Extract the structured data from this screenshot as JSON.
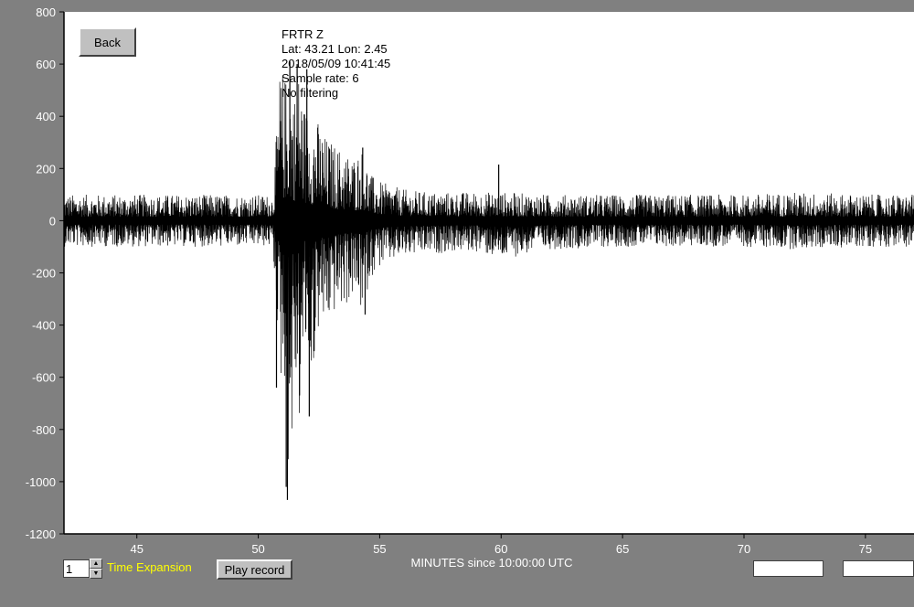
{
  "window": {
    "background": "#808080",
    "plot_background": "#ffffff",
    "trace_color": "#000000"
  },
  "info": {
    "station": "FRTR  Z",
    "location": "Lat: 43.21 Lon: 2.45",
    "datetime": "2018/05/09 10:41:45",
    "sample_rate": "Sample rate: 6",
    "filtering": "No filtering"
  },
  "buttons": {
    "back": "Back",
    "play": "Play record"
  },
  "time_expansion": {
    "value": "1",
    "label": "Time Expansion",
    "label_color": "#ffff00"
  },
  "chart_data": {
    "type": "line",
    "xlabel": "MINUTES since 10:00:00 UTC",
    "xlim": [
      42.0,
      77.0
    ],
    "ylim": [
      -1200,
      800
    ],
    "xticks": [
      "45",
      "50",
      "55",
      "60",
      "65",
      "70",
      "75"
    ],
    "yticks": [
      "800",
      "600",
      "400",
      "200",
      "0",
      "-200",
      "-400",
      "-600",
      "-800",
      "-1000",
      "-1200"
    ],
    "grid": false,
    "series": [
      {
        "envelope_x": [
          42.0,
          50.6,
          50.7,
          50.9,
          51.1,
          51.3,
          51.5,
          51.7,
          51.9,
          52.2,
          52.5,
          52.8,
          53.1,
          53.5,
          53.9,
          54.3,
          54.6,
          55.0,
          56.0,
          57.0,
          58.0,
          59.0,
          60.0,
          62.0,
          65.0,
          68.0,
          70.0,
          72.0,
          75.0,
          77.0
        ],
        "envelope_max": [
          100,
          100,
          250,
          600,
          560,
          600,
          500,
          600,
          450,
          420,
          380,
          320,
          300,
          270,
          250,
          280,
          180,
          150,
          120,
          110,
          110,
          110,
          110,
          100,
          100,
          100,
          100,
          110,
          100,
          100
        ],
        "envelope_min": [
          -100,
          -100,
          -300,
          -640,
          -620,
          -1070,
          -650,
          -800,
          -520,
          -600,
          -420,
          -420,
          -360,
          -340,
          -300,
          -360,
          -220,
          -180,
          -140,
          -130,
          -120,
          -120,
          -150,
          -110,
          -100,
          -100,
          -100,
          -110,
          -100,
          -100
        ],
        "spikes": [
          {
            "x": 50.75,
            "y": -640
          },
          {
            "x": 51.15,
            "y": -1020
          },
          {
            "x": 51.2,
            "y": -1070
          },
          {
            "x": 51.7,
            "y": -670
          },
          {
            "x": 52.1,
            "y": -750
          },
          {
            "x": 52.3,
            "y": -500
          },
          {
            "x": 54.4,
            "y": -360
          },
          {
            "x": 51.3,
            "y": 610
          },
          {
            "x": 51.6,
            "y": 600
          },
          {
            "x": 52.0,
            "y": 580
          },
          {
            "x": 54.3,
            "y": 280
          },
          {
            "x": 59.9,
            "y": 215
          }
        ]
      }
    ]
  }
}
